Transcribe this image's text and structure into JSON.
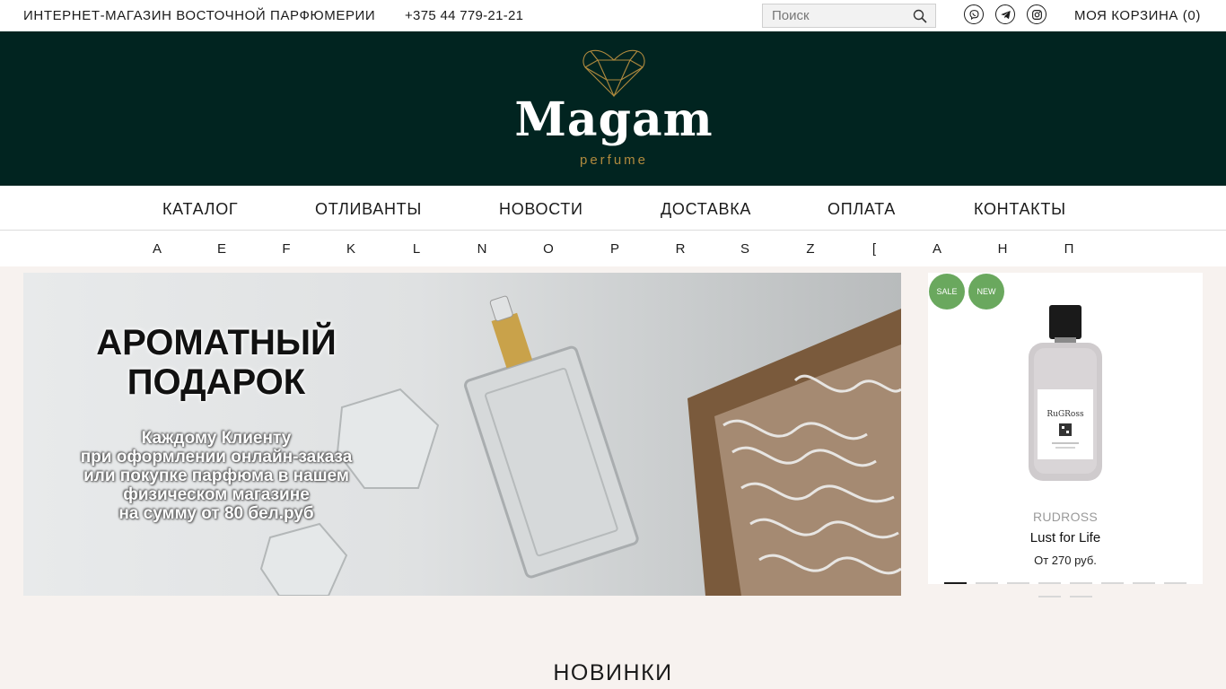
{
  "topbar": {
    "title": "ИНТЕРНЕТ-МАГАЗИН ВОСТОЧНОЙ ПАРФЮМЕРИИ",
    "phone": "+375 44 779-21-21",
    "search_placeholder": "Поиск",
    "cart_label": "МОЯ КОРЗИНА (0)",
    "social": [
      "viber-icon",
      "telegram-icon",
      "instagram-icon"
    ]
  },
  "logo": {
    "word": "Magam",
    "sub": "perfume",
    "colors": {
      "background": "#012420",
      "gold": "#b08a3e",
      "word": "#ffffff"
    }
  },
  "nav": {
    "items": [
      "КАТАЛОГ",
      "ОТЛИВАНТЫ",
      "НОВОСТИ",
      "ДОСТАВКА",
      "ОПЛАТА",
      "КОНТАКТЫ"
    ]
  },
  "letters": [
    "A",
    "E",
    "F",
    "K",
    "L",
    "N",
    "O",
    "P",
    "R",
    "S",
    "Z",
    "[",
    "А",
    "Н",
    "П"
  ],
  "banner": {
    "headline_1": "АРОМАТНЫЙ",
    "headline_2": "ПОДАРОК",
    "text_1": "Каждому Клиенту",
    "text_2": "при оформлении онлайн-заказа",
    "text_3": "или покупке парфюма в нашем",
    "text_4": "физическом магазине",
    "text_5": "на сумму от 80 бел.руб"
  },
  "product": {
    "badge_sale": "SALE",
    "badge_new": "NEW",
    "bottle_label": "RuGRoss",
    "brand": "RUDROSS",
    "name": "Lust for Life",
    "price": "От 270 руб.",
    "badge_color": "#6aa85e"
  },
  "slider": {
    "total": 10,
    "active": 1
  },
  "section": {
    "title": "НОВИНКИ"
  }
}
